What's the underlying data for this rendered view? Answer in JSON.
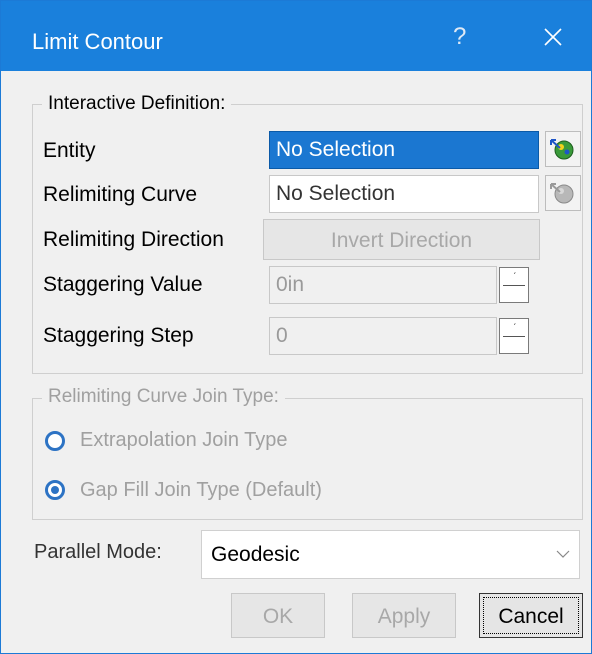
{
  "window": {
    "title": "Limit Contour",
    "help": "?"
  },
  "interactive": {
    "legend": "Interactive Definition:",
    "entity_label": "Entity",
    "entity_value": "No Selection",
    "relimiting_curve_label": "Relimiting Curve",
    "relimiting_curve_value": "No Selection",
    "relimiting_direction_label": "Relimiting Direction",
    "invert_direction_label": "Invert Direction",
    "staggering_value_label": "Staggering Value",
    "staggering_value": "0in",
    "staggering_step_label": "Staggering Step",
    "staggering_step": "0"
  },
  "join": {
    "legend": "Relimiting Curve Join Type:",
    "options": [
      {
        "label": "Extrapolation Join Type",
        "selected": false
      },
      {
        "label": "Gap Fill Join Type (Default)",
        "selected": true
      }
    ]
  },
  "parallel_mode": {
    "label": "Parallel Mode:",
    "value": "Geodesic"
  },
  "buttons": {
    "ok": "OK",
    "apply": "Apply",
    "cancel": "Cancel"
  },
  "colors": {
    "titlebar": "#1a80dc",
    "selection": "#1b77d1",
    "radio": "#2d73c4"
  },
  "icons": {
    "close": "close-icon",
    "help": "help-icon",
    "picker": "selection-picker-icon"
  }
}
